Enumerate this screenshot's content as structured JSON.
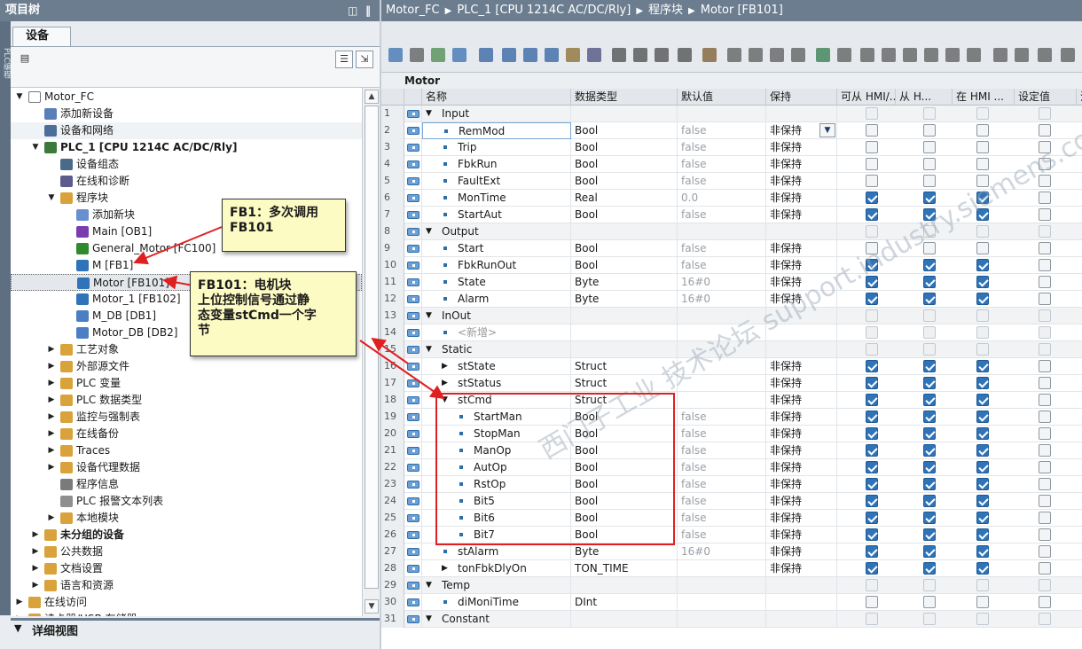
{
  "left_panel": {
    "title": "项目树",
    "side_label": "PLC编程",
    "tab": "设备",
    "tree": [
      {
        "label": "Motor_FC",
        "level": 0,
        "toggle": "▼",
        "icon": "project-icon"
      },
      {
        "label": "添加新设备",
        "level": 1,
        "toggle": "",
        "icon": "add-device-icon"
      },
      {
        "label": "设备和网络",
        "level": 1,
        "toggle": "",
        "icon": "network-icon"
      },
      {
        "label": "PLC_1 [CPU 1214C AC/DC/Rly]",
        "level": 1,
        "toggle": "▼",
        "icon": "plc-icon",
        "bold": true
      },
      {
        "label": "设备组态",
        "level": 2,
        "toggle": "",
        "icon": "config-icon"
      },
      {
        "label": "在线和诊断",
        "level": 2,
        "toggle": "",
        "icon": "diagnostic-icon"
      },
      {
        "label": "程序块",
        "level": 2,
        "toggle": "▼",
        "icon": "folder-icon"
      },
      {
        "label": "添加新块",
        "level": 3,
        "toggle": "",
        "icon": "add-block-icon"
      },
      {
        "label": "Main [OB1]",
        "level": 3,
        "toggle": "",
        "icon": "ob-icon"
      },
      {
        "label": "General_Motor [FC100]",
        "level": 3,
        "toggle": "",
        "icon": "fc-icon"
      },
      {
        "label": "M [FB1]",
        "level": 3,
        "toggle": "",
        "icon": "fb-icon"
      },
      {
        "label": "Motor [FB101]",
        "level": 3,
        "toggle": "",
        "icon": "fb-icon",
        "selected": true
      },
      {
        "label": "Motor_1 [FB102]",
        "level": 3,
        "toggle": "",
        "icon": "fb-icon"
      },
      {
        "label": "M_DB [DB1]",
        "level": 3,
        "toggle": "",
        "icon": "db-icon"
      },
      {
        "label": "Motor_DB [DB2]",
        "level": 3,
        "toggle": "",
        "icon": "db-icon"
      },
      {
        "label": "工艺对象",
        "level": 2,
        "toggle": "▶",
        "icon": "folder-icon"
      },
      {
        "label": "外部源文件",
        "level": 2,
        "toggle": "▶",
        "icon": "folder-icon"
      },
      {
        "label": "PLC 变量",
        "level": 2,
        "toggle": "▶",
        "icon": "folder-icon"
      },
      {
        "label": "PLC 数据类型",
        "level": 2,
        "toggle": "▶",
        "icon": "folder-icon"
      },
      {
        "label": "监控与强制表",
        "level": 2,
        "toggle": "▶",
        "icon": "folder-icon"
      },
      {
        "label": "在线备份",
        "level": 2,
        "toggle": "▶",
        "icon": "folder-icon"
      },
      {
        "label": "Traces",
        "level": 2,
        "toggle": "▶",
        "icon": "folder-icon"
      },
      {
        "label": "设备代理数据",
        "level": 2,
        "toggle": "▶",
        "icon": "folder-icon"
      },
      {
        "label": "程序信息",
        "level": 2,
        "toggle": "",
        "icon": "info-icon"
      },
      {
        "label": "PLC 报警文本列表",
        "level": 2,
        "toggle": "",
        "icon": "alarm-text-icon"
      },
      {
        "label": "本地模块",
        "level": 2,
        "toggle": "▶",
        "icon": "folder-icon"
      },
      {
        "label": "未分组的设备",
        "level": 1,
        "toggle": "▶",
        "icon": "folder-icon",
        "bold": true
      },
      {
        "label": "公共数据",
        "level": 1,
        "toggle": "▶",
        "icon": "folder-icon"
      },
      {
        "label": "文档设置",
        "level": 1,
        "toggle": "▶",
        "icon": "folder-icon"
      },
      {
        "label": "语言和资源",
        "level": 1,
        "toggle": "▶",
        "icon": "folder-icon"
      },
      {
        "label": "在线访问",
        "level": 0,
        "toggle": "▶",
        "icon": "folder-icon"
      },
      {
        "label": "读卡器/USB 存储器",
        "level": 0,
        "toggle": "▶",
        "icon": "folder-icon"
      }
    ],
    "detail_view": "详细视图"
  },
  "breadcrumb": [
    "Motor_FC",
    "PLC_1 [CPU 1214C AC/DC/Rly]",
    "程序块",
    "Motor [FB101]"
  ],
  "block_title": "Motor",
  "columns": [
    "名称",
    "数据类型",
    "默认值",
    "保持",
    "可从 HMI/...",
    "从 H...",
    "在 HMI ...",
    "设定值",
    "注"
  ],
  "rows": [
    {
      "n": "1",
      "name": "Input",
      "level": 0,
      "type": "",
      "default": "",
      "retain": "",
      "group": true,
      "toggle": "▼",
      "checks": [
        0,
        0,
        0,
        0
      ]
    },
    {
      "n": "2",
      "name": "RemMod",
      "level": 1,
      "type": "Bool",
      "default": "false",
      "retain": "非保持",
      "checks": [
        0,
        0,
        0,
        0
      ],
      "dropdown": true
    },
    {
      "n": "3",
      "name": "Trip",
      "level": 1,
      "type": "Bool",
      "default": "false",
      "retain": "非保持",
      "checks": [
        0,
        0,
        0,
        0
      ]
    },
    {
      "n": "4",
      "name": "FbkRun",
      "level": 1,
      "type": "Bool",
      "default": "false",
      "retain": "非保持",
      "checks": [
        0,
        0,
        0,
        0
      ]
    },
    {
      "n": "5",
      "name": "FaultExt",
      "level": 1,
      "type": "Bool",
      "default": "false",
      "retain": "非保持",
      "checks": [
        0,
        0,
        0,
        0
      ]
    },
    {
      "n": "6",
      "name": "MonTime",
      "level": 1,
      "type": "Real",
      "default": "0.0",
      "retain": "非保持",
      "checks": [
        1,
        1,
        1,
        0
      ]
    },
    {
      "n": "7",
      "name": "StartAut",
      "level": 1,
      "type": "Bool",
      "default": "false",
      "retain": "非保持",
      "checks": [
        1,
        1,
        1,
        0
      ]
    },
    {
      "n": "8",
      "name": "Output",
      "level": 0,
      "type": "",
      "default": "",
      "retain": "",
      "group": true,
      "toggle": "▼",
      "checks": [
        0,
        0,
        0,
        0
      ]
    },
    {
      "n": "9",
      "name": "Start",
      "level": 1,
      "type": "Bool",
      "default": "false",
      "retain": "非保持",
      "checks": [
        0,
        0,
        0,
        0
      ]
    },
    {
      "n": "10",
      "name": "FbkRunOut",
      "level": 1,
      "type": "Bool",
      "default": "false",
      "retain": "非保持",
      "checks": [
        1,
        1,
        1,
        0
      ]
    },
    {
      "n": "11",
      "name": "State",
      "level": 1,
      "type": "Byte",
      "default": "16#0",
      "retain": "非保持",
      "checks": [
        1,
        1,
        1,
        0
      ]
    },
    {
      "n": "12",
      "name": "Alarm",
      "level": 1,
      "type": "Byte",
      "default": "16#0",
      "retain": "非保持",
      "checks": [
        1,
        1,
        1,
        0
      ]
    },
    {
      "n": "13",
      "name": "InOut",
      "level": 0,
      "type": "",
      "default": "",
      "retain": "",
      "group": true,
      "toggle": "▼",
      "checks": [
        0,
        0,
        0,
        0
      ]
    },
    {
      "n": "14",
      "name": "<新增>",
      "level": 1,
      "type": "",
      "default": "",
      "retain": "",
      "isnew": true,
      "checks": [
        0,
        0,
        0,
        0
      ]
    },
    {
      "n": "15",
      "name": "Static",
      "level": 0,
      "type": "",
      "default": "",
      "retain": "",
      "group": true,
      "toggle": "▼",
      "checks": [
        0,
        0,
        0,
        0
      ]
    },
    {
      "n": "16",
      "name": "stState",
      "level": 1,
      "type": "Struct",
      "default": "",
      "retain": "非保持",
      "toggle": "▶",
      "checks": [
        1,
        1,
        1,
        0
      ]
    },
    {
      "n": "17",
      "name": "stStatus",
      "level": 1,
      "type": "Struct",
      "default": "",
      "retain": "非保持",
      "toggle": "▶",
      "checks": [
        1,
        1,
        1,
        0
      ]
    },
    {
      "n": "18",
      "name": "stCmd",
      "level": 1,
      "type": "Struct",
      "default": "",
      "retain": "非保持",
      "toggle": "▼",
      "checks": [
        1,
        1,
        1,
        0
      ]
    },
    {
      "n": "19",
      "name": "StartMan",
      "level": 2,
      "type": "Bool",
      "default": "false",
      "retain": "非保持",
      "checks": [
        1,
        1,
        1,
        0
      ]
    },
    {
      "n": "20",
      "name": "StopMan",
      "level": 2,
      "type": "Bool",
      "default": "false",
      "retain": "非保持",
      "checks": [
        1,
        1,
        1,
        0
      ]
    },
    {
      "n": "21",
      "name": "ManOp",
      "level": 2,
      "type": "Bool",
      "default": "false",
      "retain": "非保持",
      "checks": [
        1,
        1,
        1,
        0
      ]
    },
    {
      "n": "22",
      "name": "AutOp",
      "level": 2,
      "type": "Bool",
      "default": "false",
      "retain": "非保持",
      "checks": [
        1,
        1,
        1,
        0
      ]
    },
    {
      "n": "23",
      "name": "RstOp",
      "level": 2,
      "type": "Bool",
      "default": "false",
      "retain": "非保持",
      "checks": [
        1,
        1,
        1,
        0
      ]
    },
    {
      "n": "24",
      "name": "Bit5",
      "level": 2,
      "type": "Bool",
      "default": "false",
      "retain": "非保持",
      "checks": [
        1,
        1,
        1,
        0
      ]
    },
    {
      "n": "25",
      "name": "Bit6",
      "level": 2,
      "type": "Bool",
      "default": "false",
      "retain": "非保持",
      "checks": [
        1,
        1,
        1,
        0
      ]
    },
    {
      "n": "26",
      "name": "Bit7",
      "level": 2,
      "type": "Bool",
      "default": "false",
      "retain": "非保持",
      "checks": [
        1,
        1,
        1,
        0
      ]
    },
    {
      "n": "27",
      "name": "stAlarm",
      "level": 1,
      "type": "Byte",
      "default": "16#0",
      "retain": "非保持",
      "checks": [
        1,
        1,
        1,
        0
      ]
    },
    {
      "n": "28",
      "name": "tonFbkDlyOn",
      "level": 1,
      "type": "TON_TIME",
      "default": "",
      "retain": "非保持",
      "toggle": "▶",
      "checks": [
        1,
        1,
        1,
        0
      ]
    },
    {
      "n": "29",
      "name": "Temp",
      "level": 0,
      "type": "",
      "default": "",
      "retain": "",
      "group": true,
      "toggle": "▼",
      "checks": [
        0,
        0,
        0,
        0
      ]
    },
    {
      "n": "30",
      "name": "diMoniTime",
      "level": 1,
      "type": "DInt",
      "default": "",
      "retain": "",
      "checks": [
        0,
        0,
        0,
        0
      ]
    },
    {
      "n": "31",
      "name": "Constant",
      "level": 0,
      "type": "",
      "default": "",
      "retain": "",
      "group": true,
      "toggle": "▼",
      "checks": [
        0,
        0,
        0,
        0
      ]
    }
  ],
  "callouts": {
    "fb1": "FB1：多次调用\nFB101",
    "fb101": "FB101：电机块\n上位控制信号通过静\n态变量stCmd一个字\n节"
  },
  "watermark": "西门子工业 技术论坛 support.industry.siemens.com"
}
